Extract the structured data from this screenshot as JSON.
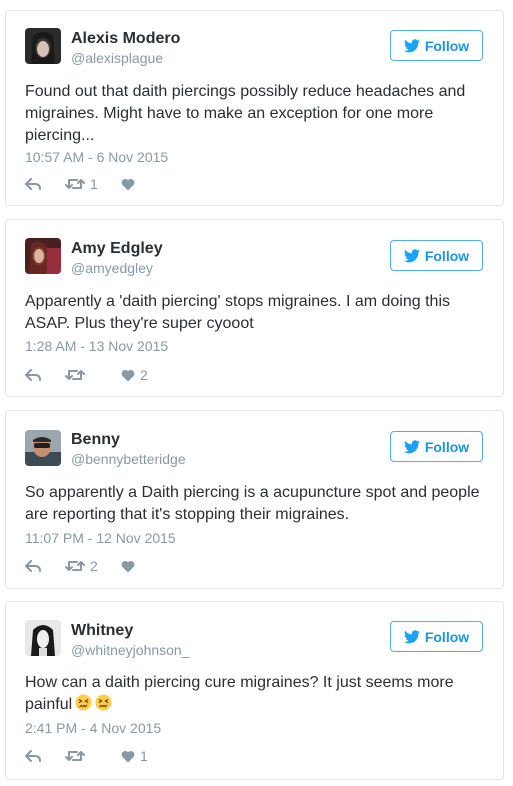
{
  "follow_label": "Follow",
  "icons": {
    "follow": "twitter-bird-icon",
    "reply": "reply-arrow-icon",
    "retweet": "retweet-icon",
    "like": "heart-icon",
    "emoji": "confounded-face-emoji"
  },
  "colors": {
    "accent": "#1b95e0",
    "border": "#e1e8ed",
    "muted": "#8899a6",
    "text": "#292f33"
  },
  "tweets": [
    {
      "name": "Alexis Modero",
      "handle": "@alexisplague",
      "text": "Found out that daith piercings possibly reduce headaches and migraines. Might have to make an exception for one more piercing...",
      "timestamp": "10:57 AM - 6 Nov 2015",
      "retweets": "1",
      "likes": ""
    },
    {
      "name": "Amy Edgley",
      "handle": "@amyedgley",
      "text": "Apparently a 'daith piercing' stops migraines. I am doing this ASAP. Plus they're super cyooot",
      "timestamp": "1:28 AM - 13 Nov 2015",
      "retweets": "",
      "likes": "2"
    },
    {
      "name": "Benny",
      "handle": "@bennybetteridge",
      "text": "So apparently a Daith piercing is a acupuncture spot and people are reporting that it's stopping their migraines.",
      "timestamp": "11:07 PM - 12 Nov 2015",
      "retweets": "2",
      "likes": ""
    },
    {
      "name": "Whitney",
      "handle": "@whitneyjohnson_",
      "text": "How can a daith piercing cure migraines? It just seems more painful",
      "timestamp": "2:41 PM - 4 Nov 2015",
      "retweets": "",
      "likes": "1"
    }
  ]
}
